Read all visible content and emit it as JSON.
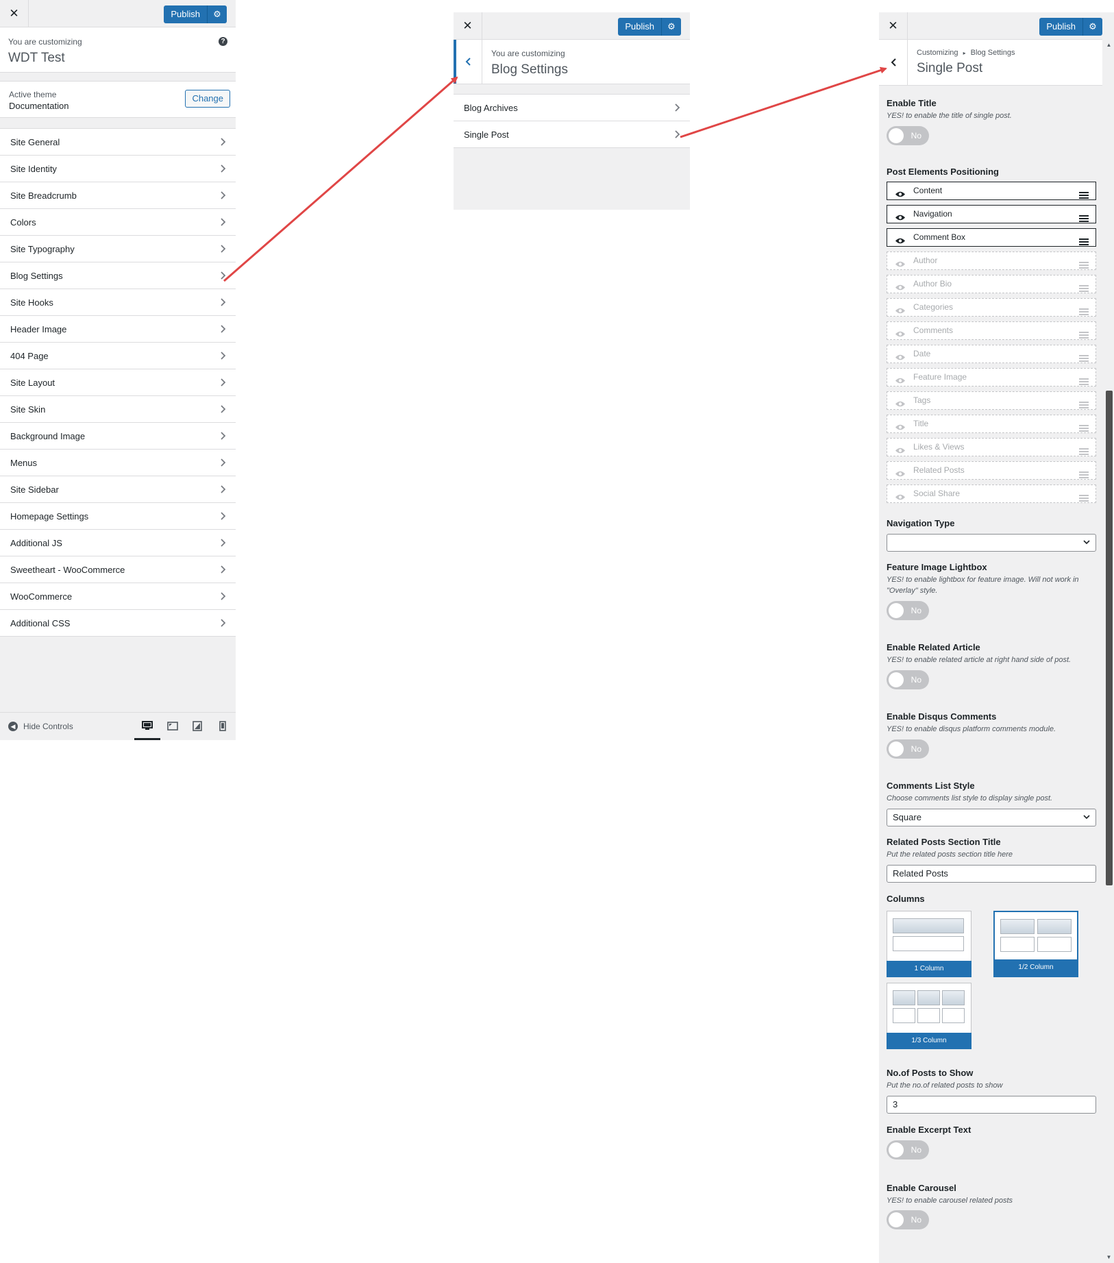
{
  "panel1": {
    "publish_label": "Publish",
    "customizing_label": "You are customizing",
    "site_title": "WDT Test",
    "active_theme_label": "Active theme",
    "theme_name": "Documentation",
    "change_label": "Change",
    "sections": [
      "Site General",
      "Site Identity",
      "Site Breadcrumb",
      "Colors",
      "Site Typography",
      "Blog Settings",
      "Site Hooks",
      "Header Image",
      "404 Page",
      "Site Layout",
      "Site Skin",
      "Background Image",
      "Menus",
      "Site Sidebar",
      "Homepage Settings",
      "Additional JS",
      "Sweetheart - WooCommerce",
      "WooCommerce",
      "Additional CSS"
    ],
    "hide_controls_label": "Hide Controls"
  },
  "panel2": {
    "publish_label": "Publish",
    "customizing_label": "You are customizing",
    "section_title": "Blog Settings",
    "items": [
      "Blog Archives",
      "Single Post"
    ]
  },
  "panel3": {
    "publish_label": "Publish",
    "breadcrumb_root": "Customizing",
    "breadcrumb_parent": "Blog Settings",
    "section_title": "Single Post",
    "toggle_no": "No",
    "enable_title": {
      "label": "Enable Title",
      "desc": "YES! to enable the title of single post."
    },
    "positioning_label": "Post Elements Positioning",
    "active_elements": [
      "Content",
      "Navigation",
      "Comment Box"
    ],
    "inactive_elements": [
      "Author",
      "Author Bio",
      "Categories",
      "Comments",
      "Date",
      "Feature Image",
      "Tags",
      "Title",
      "Likes & Views",
      "Related Posts",
      "Social Share"
    ],
    "navigation_type_label": "Navigation Type",
    "navigation_type_value": "",
    "lightbox": {
      "label": "Feature Image Lightbox",
      "desc": "YES! to enable lightbox for feature image. Will not work in \"Overlay\" style."
    },
    "related_article": {
      "label": "Enable Related Article",
      "desc": "YES! to enable related article at right hand side of post."
    },
    "disqus": {
      "label": "Enable Disqus Comments",
      "desc": "YES! to enable disqus platform comments module."
    },
    "comments_style": {
      "label": "Comments List Style",
      "desc": "Choose comments list style to display single post.",
      "value": "Square"
    },
    "related_title": {
      "label": "Related Posts Section Title",
      "desc": "Put the related posts section title here",
      "value": "Related Posts"
    },
    "columns_label": "Columns",
    "column_options": [
      "1 Column",
      "1/2 Column",
      "1/3 Column"
    ],
    "posts_count": {
      "label": "No.of Posts to Show",
      "desc": "Put the no.of related posts to show",
      "value": "3"
    },
    "excerpt": {
      "label": "Enable Excerpt Text"
    },
    "carousel": {
      "label": "Enable Carousel",
      "desc": "YES! to enable carousel related posts"
    }
  },
  "colors": {
    "accent": "#2271b1",
    "arrow": "#e04646"
  }
}
